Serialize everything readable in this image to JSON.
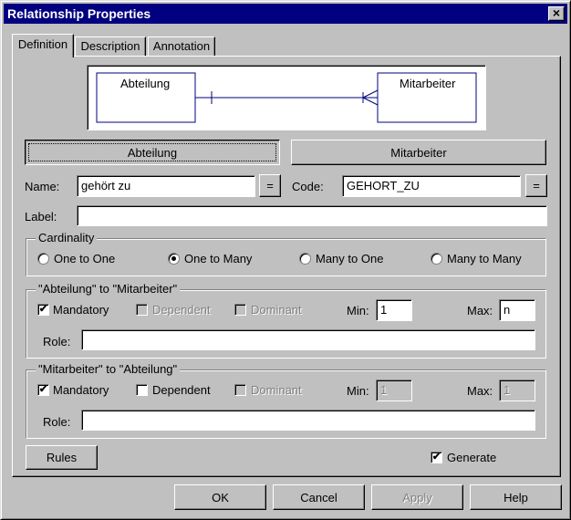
{
  "window": {
    "title": "Relationship Properties",
    "close_glyph": "×"
  },
  "tabs": [
    {
      "label": "Definition",
      "active": true
    },
    {
      "label": "Description",
      "active": false
    },
    {
      "label": "Annotation",
      "active": false
    }
  ],
  "diagram": {
    "left_entity": "Abteilung",
    "right_entity": "Mitarbeiter"
  },
  "entity_buttons": {
    "left": "Abteilung",
    "right": "Mitarbeiter"
  },
  "name": {
    "label": "Name:",
    "value": "gehört zu",
    "eq_button": "="
  },
  "code": {
    "label": "Code:",
    "value": "GEHORT_ZU",
    "eq_button": "="
  },
  "label_field": {
    "label": "Label:",
    "value": ""
  },
  "cardinality": {
    "title": "Cardinality",
    "options": [
      {
        "label": "One to One",
        "selected": false
      },
      {
        "label": "One to Many",
        "selected": true
      },
      {
        "label": "Many to One",
        "selected": false
      },
      {
        "label": "Many to Many",
        "selected": false
      }
    ]
  },
  "role1": {
    "title": "\"Abteilung\" to \"Mitarbeiter\"",
    "mandatory": {
      "label": "Mandatory",
      "checked": true
    },
    "dependent": {
      "label": "Dependent",
      "checked": false
    },
    "dominant": {
      "label": "Dominant",
      "checked": false
    },
    "min_label": "Min:",
    "min_value": "1",
    "max_label": "Max:",
    "max_value": "n",
    "role_label": "Role:",
    "role_value": ""
  },
  "role2": {
    "title": "\"Mitarbeiter\" to \"Abteilung\"",
    "mandatory": {
      "label": "Mandatory",
      "checked": true
    },
    "dependent": {
      "label": "Dependent",
      "checked": false
    },
    "dominant": {
      "label": "Dominant",
      "checked": false
    },
    "min_label": "Min:",
    "min_value": "1",
    "max_label": "Max:",
    "max_value": "1",
    "role_label": "Role:",
    "role_value": ""
  },
  "rules_button": "Rules",
  "generate": {
    "label": "Generate",
    "checked": true
  },
  "check_glyph": "✔",
  "footer": {
    "ok": "OK",
    "cancel": "Cancel",
    "apply": "Apply",
    "help": "Help"
  }
}
